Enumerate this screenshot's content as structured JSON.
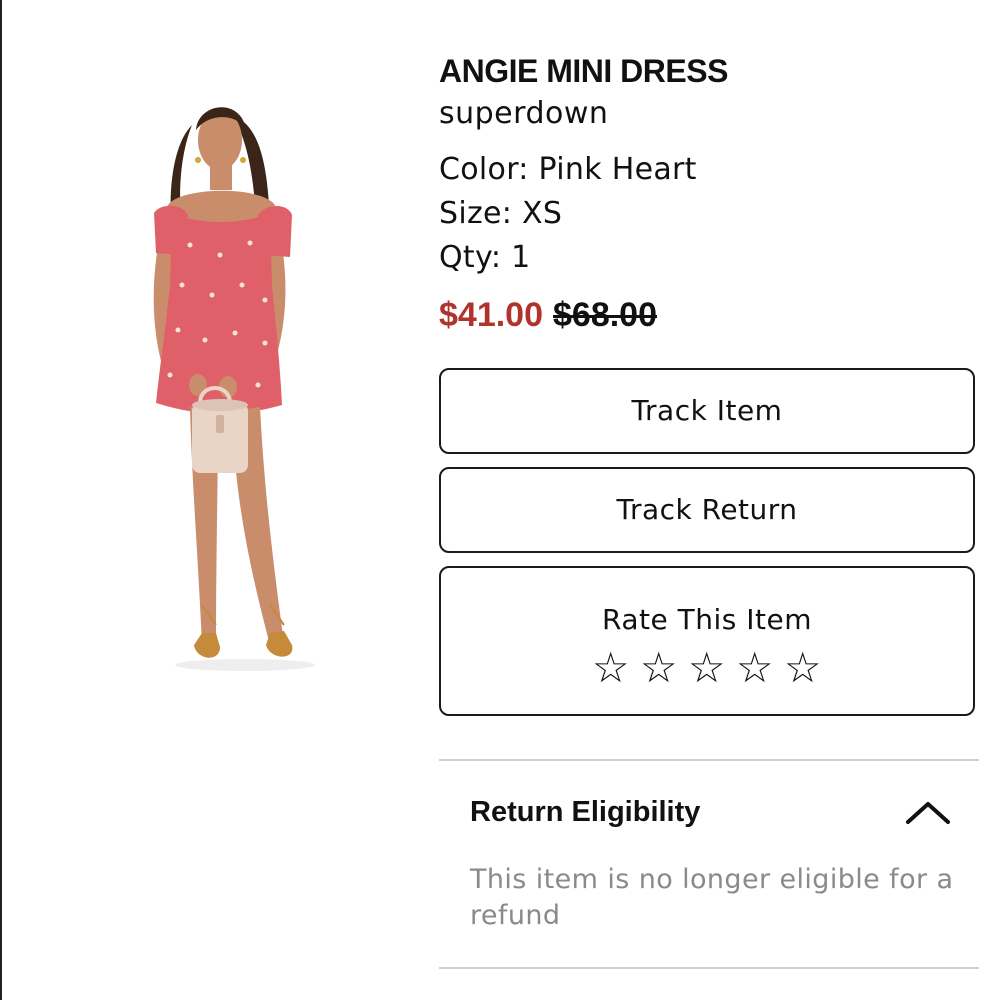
{
  "product": {
    "title": "ANGIE MINI DRESS",
    "brand": "superdown",
    "color_line": "Color: Pink Heart",
    "size_line": "Size: XS",
    "qty_line": "Qty: 1",
    "sale_price": "$41.00",
    "original_price": "$68.00",
    "image_icon": "product-photo-pink-dress",
    "colors": {
      "sale_price": "#b0342d",
      "dress": "#e0606a",
      "bag": "#ead4c6"
    }
  },
  "actions": {
    "track_item_label": "Track Item",
    "track_return_label": "Track Return",
    "rate_label": "Rate This Item",
    "star_glyph": "☆",
    "rating_value": 0,
    "rating_max": 5
  },
  "returns": {
    "heading": "Return Eligibility",
    "toggle_icon": "chevron-up-icon",
    "message": "This item is no longer eligible for a refund"
  }
}
